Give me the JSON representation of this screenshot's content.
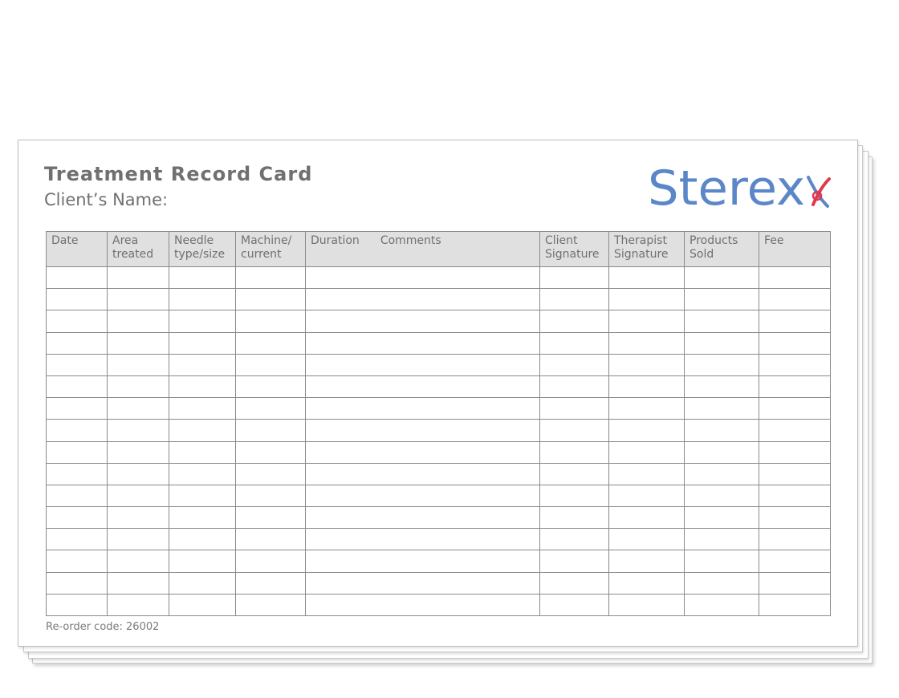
{
  "card": {
    "title": "Treatment Record Card",
    "client_label": "Client’s Name:",
    "reorder_text": "Re-order code: 26002"
  },
  "logo": {
    "text": "Sterex",
    "color": "#5b86c8",
    "accent_color": "#e0394f"
  },
  "table": {
    "headers": [
      {
        "line1": "Date",
        "line2": ""
      },
      {
        "line1": "Area",
        "line2": "treated"
      },
      {
        "line1": "Needle",
        "line2": "type/size"
      },
      {
        "line1": "Machine/",
        "line2": "current"
      },
      {
        "line1": "Duration",
        "line2": "Comments"
      },
      {
        "line1": "Client",
        "line2": "Signature"
      },
      {
        "line1": "Therapist",
        "line2": "Signature"
      },
      {
        "line1": "Products",
        "line2": "Sold"
      },
      {
        "line1": "Fee",
        "line2": ""
      }
    ],
    "empty_rows": 16
  }
}
